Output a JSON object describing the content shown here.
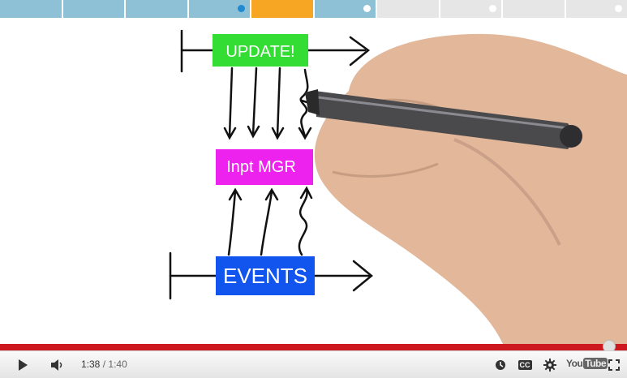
{
  "lesson_nav": {
    "segments": [
      {
        "state": "done",
        "dot": "none"
      },
      {
        "state": "done",
        "dot": "none"
      },
      {
        "state": "done",
        "dot": "none"
      },
      {
        "state": "done",
        "dot": "blue"
      },
      {
        "state": "current",
        "dot": "none"
      },
      {
        "state": "done",
        "dot": "white"
      },
      {
        "state": "todo",
        "dot": "none"
      },
      {
        "state": "todo",
        "dot": "white"
      },
      {
        "state": "todo",
        "dot": "none"
      },
      {
        "state": "todo",
        "dot": "white"
      }
    ],
    "colors": {
      "done": "#8ec1d6",
      "current": "#f6a623",
      "todo": "#e6e6e6"
    }
  },
  "video": {
    "diagram": {
      "boxes": {
        "update": {
          "text": "UPDATE!",
          "color": "#33dd33"
        },
        "input_mgr": {
          "text": "Inpt MGR",
          "color": "#ee22ee"
        },
        "events": {
          "text": "EVENTS",
          "color": "#1155ee"
        }
      }
    }
  },
  "player": {
    "progress_fraction": 0.975,
    "current_time": "1:38",
    "separator": "/",
    "duration": "1:40",
    "icons": [
      "play-icon",
      "volume-icon",
      "watch-later-icon",
      "captions-icon",
      "settings-icon",
      "youtube-logo",
      "fullscreen-icon"
    ],
    "cc_label": "CC",
    "logo_you": "You",
    "logo_tube": "Tube",
    "accent_color": "#cc181e"
  }
}
